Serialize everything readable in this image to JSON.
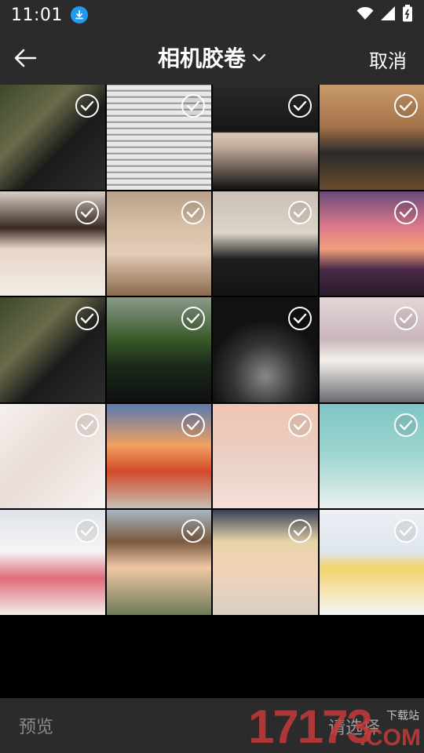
{
  "status_bar": {
    "time": "11:01"
  },
  "header": {
    "title": "相机胶卷",
    "cancel_label": "取消"
  },
  "bottom_bar": {
    "preview_label": "预览",
    "select_label": "请选择"
  },
  "watermark": {
    "number": "17173",
    "domain": ".COM",
    "small_text": "下载站"
  },
  "photos": [
    {
      "name": "car-interior-sunset",
      "selected": true,
      "bg": "linear-gradient(135deg,#3b4a2a 0%,#6a6a4a 35%,#1b1b1b 60%,#2d2d2d 100%)"
    },
    {
      "name": "handwritten-page",
      "selected": true,
      "bg": "repeating-linear-gradient(0deg,#e9e9e9 0px,#e9e9e9 5px,#7a7a7a 6px,#e9e9e9 8px)"
    },
    {
      "name": "person-black-hoodie",
      "selected": true,
      "bg": "linear-gradient(180deg,#2a2a2a 0%,#161616 45%,#d8c8b8 46%,#c0a898 60%,#111 100%)"
    },
    {
      "name": "offroad-suv-dust",
      "selected": true,
      "bg": "linear-gradient(180deg,#c89a6a 0%,#a4734a 40%,#2a2a2a 65%,#6b4a2d 100%)"
    },
    {
      "name": "girl-lying-scarf",
      "selected": true,
      "bg": "linear-gradient(180deg,#d9cfc6 0%,#3a2a22 35%,#e8d6c8 55%,#f1ece4 100%)"
    },
    {
      "name": "girl-knit-hat",
      "selected": true,
      "bg": "linear-gradient(180deg,#b8a089 0%,#d9c2a8 35%,#e3cbb6 60%,#8b6a4e 100%)"
    },
    {
      "name": "man-camera-mirror",
      "selected": true,
      "bg": "linear-gradient(180deg,#c9c1b6 0%,#ddd4c8 40%,#1e1e1e 65%,#141414 100%)"
    },
    {
      "name": "sunset-sea",
      "selected": true,
      "bg": "linear-gradient(180deg,#6a4a7a 0%,#e07a8a 35%,#f1a07a 55%,#4a2a4a 75%,#2a1a2a 100%)"
    },
    {
      "name": "car-interior-sunset-2",
      "selected": true,
      "bg": "linear-gradient(135deg,#3b4a2a 0%,#6a6a4a 35%,#1b1b1b 60%,#2d2d2d 100%)"
    },
    {
      "name": "black-sedan-street",
      "selected": true,
      "bg": "linear-gradient(180deg,#8a9a8a 0%,#3a5a2a 40%,#1a2a1a 65%,#0f0f0f 100%)"
    },
    {
      "name": "mercedes-steering-wheel",
      "selected": true,
      "bg": "radial-gradient(circle at 50% 75%,#888 0%,#333 35%,#111 60%),linear-gradient(180deg,#9ab0b8 0%,#222 50%)"
    },
    {
      "name": "girl-holding-cat",
      "selected": true,
      "bg": "linear-gradient(180deg,#e6d6d8 0%,#c8b6ba 40%,#f4f0ea 60%,#6a6a72 100%)"
    },
    {
      "name": "anime-girl-sketch",
      "selected": true,
      "bg": "linear-gradient(135deg,#f6f1ef 0%,#e9dcd6 45%,#f8f4f1 100%)"
    },
    {
      "name": "forbidden-city-sunset",
      "selected": true,
      "bg": "linear-gradient(180deg,#5a7ab0 0%,#f1a060 40%,#d24a2a 65%,#c8bfb6 100%)"
    },
    {
      "name": "text-note-sunset",
      "selected": true,
      "bg": "linear-gradient(180deg,#f0c6b2 0%,#e9cfc4 50%,#f4e0d8 100%)"
    },
    {
      "name": "two-white-cats",
      "selected": true,
      "bg": "linear-gradient(180deg,#7fc6c6 0%,#9fd6d0 50%,#e9f1ef 100%)"
    },
    {
      "name": "fluffy-dog",
      "selected": true,
      "bg": "linear-gradient(180deg,#dfe3ea 0%,#f5f5f3 40%,#e06a7a 65%,#f2efe8 100%)"
    },
    {
      "name": "cartoon-boy-backpack",
      "selected": true,
      "bg": "linear-gradient(180deg,#a8b6c4 0%,#7a5a3e 30%,#f0c8a6 55%,#6e7a58 100%)"
    },
    {
      "name": "cartoon-boy-blonde",
      "selected": true,
      "bg": "linear-gradient(180deg,#3a4058 0%,#e6d4a8 30%,#f3d2b8 55%,#d8d0c4 100%)"
    },
    {
      "name": "chibi-boy-star",
      "selected": true,
      "bg": "linear-gradient(180deg,#eceff4 0%,#dfe6ee 40%,#f3d36a 55%,#f4f6f8 100%)"
    }
  ]
}
